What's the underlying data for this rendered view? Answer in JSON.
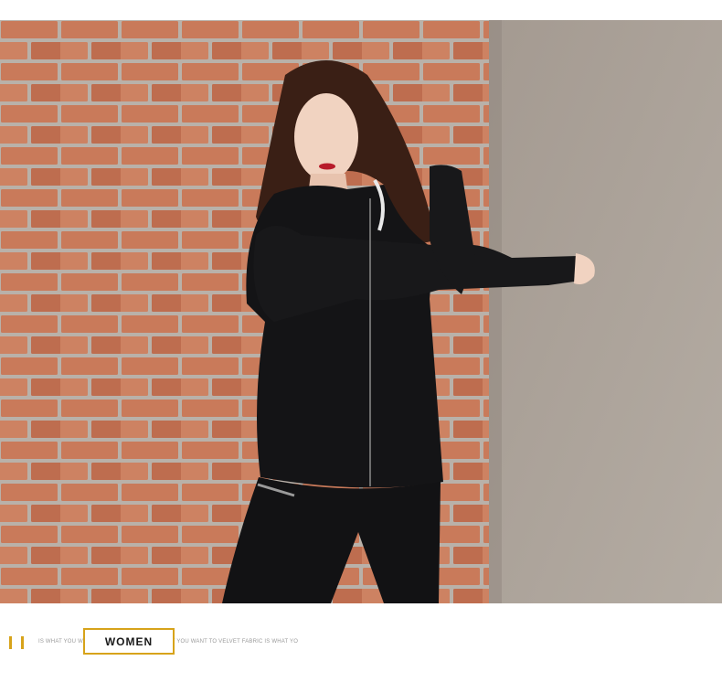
{
  "footer": {
    "tagline": "IS WHAT YOU WANT TO VELVET FABRIC IS WHAT YOU WANT TO VELVET FABRIC IS WHAT YO",
    "badge": "WOMEN"
  },
  "colors": {
    "accent": "#d7a31a",
    "brick": "#c97a5a",
    "mortar": "#b9b1a9",
    "concrete": "#a8a097",
    "garment": "#141416"
  }
}
